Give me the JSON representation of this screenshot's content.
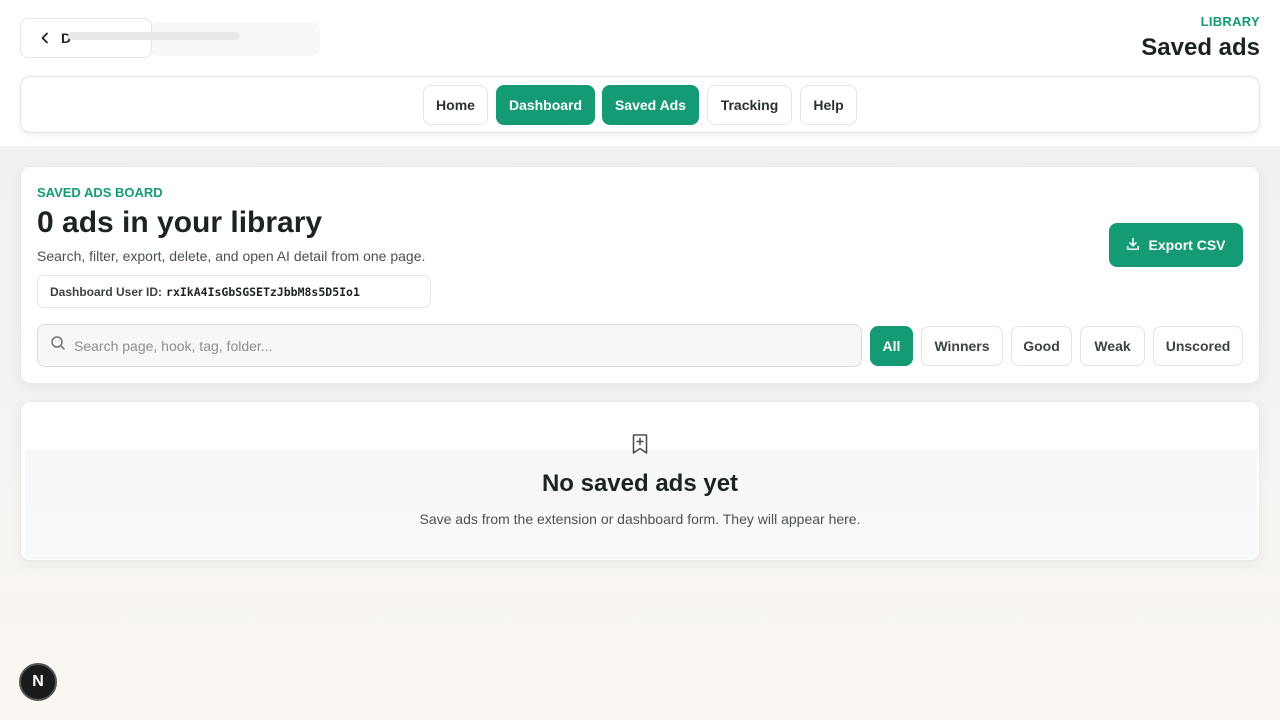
{
  "header": {
    "back_label": "D",
    "kicker": "LIBRARY",
    "title": "Saved ads"
  },
  "nav": {
    "items": [
      {
        "label": "Home",
        "active": false
      },
      {
        "label": "Dashboard",
        "active": true
      },
      {
        "label": "Saved Ads",
        "active": true
      },
      {
        "label": "Tracking",
        "active": false
      },
      {
        "label": "Help",
        "active": false
      }
    ]
  },
  "board": {
    "kicker": "SAVED ADS BOARD",
    "headline": "0 ads in your library",
    "subline": "Search, filter, export, delete, and open AI detail from one page.",
    "user_id_label": "Dashboard User ID:",
    "user_id_value": "rxIkA4IsGbSGSETzJbbM8s5D5Io1",
    "export_label": "Export CSV",
    "search_placeholder": "Search page, hook, tag, folder...",
    "search_value": "",
    "filters": [
      {
        "label": "All",
        "active": true
      },
      {
        "label": "Winners",
        "active": false
      },
      {
        "label": "Good",
        "active": false
      },
      {
        "label": "Weak",
        "active": false
      },
      {
        "label": "Unscored",
        "active": false
      }
    ]
  },
  "empty_state": {
    "title": "No saved ads yet",
    "message": "Save ads from the extension or dashboard form. They will appear here."
  },
  "dev_badge": {
    "label": "N"
  },
  "colors": {
    "accent": "#149a74",
    "text": "#1c2420",
    "muted": "#4a524e"
  },
  "icons": {
    "back": "chevron-left-icon",
    "export": "download-icon",
    "search": "search-icon",
    "empty": "bookmark-plus-icon"
  }
}
